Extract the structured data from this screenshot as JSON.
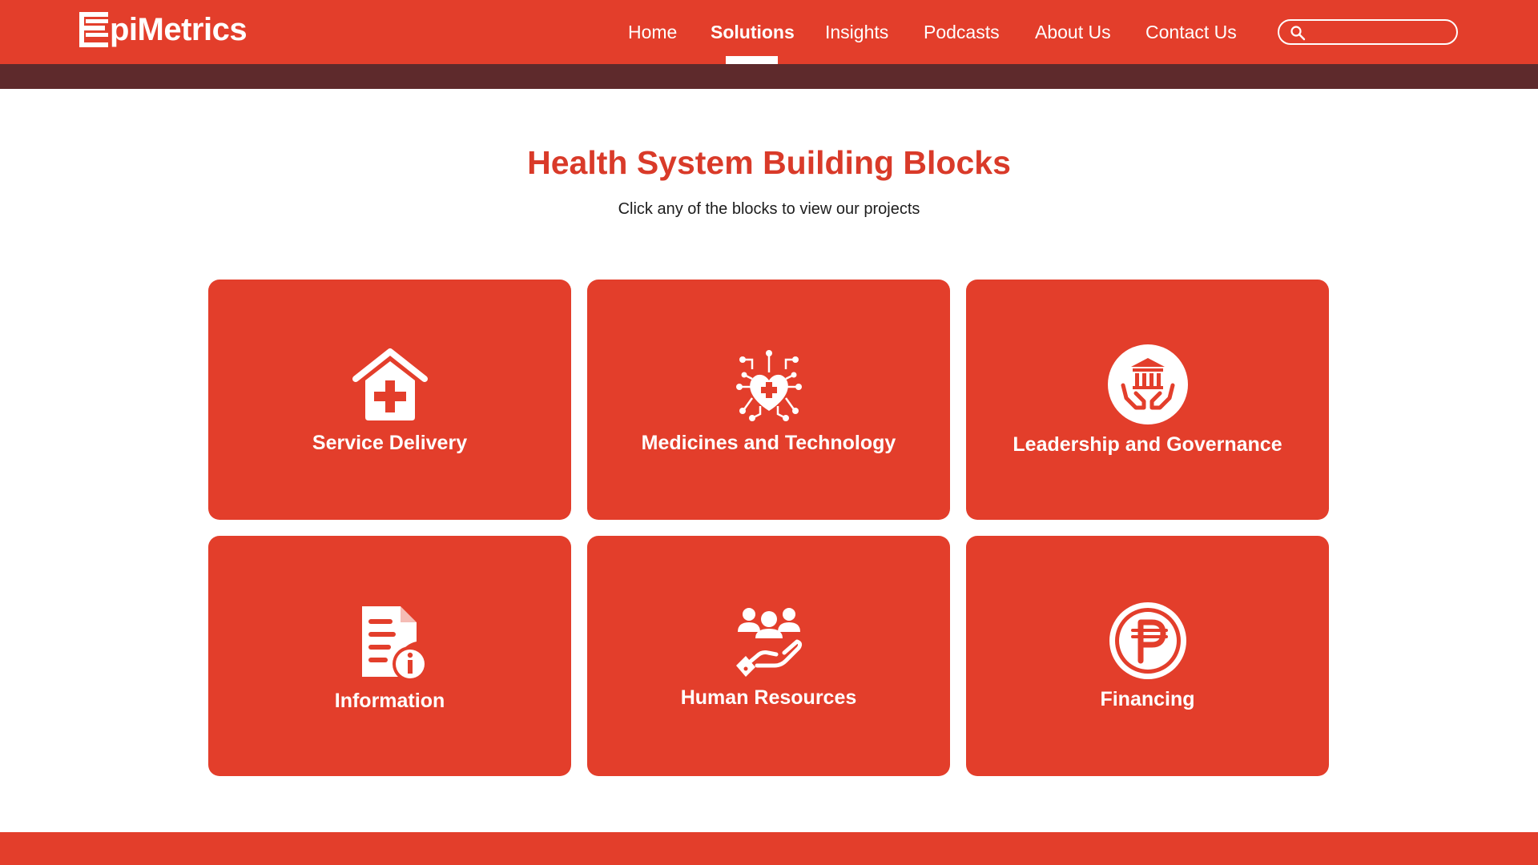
{
  "brand": {
    "name": "EpiMetrics",
    "logo_text": "piMetrics"
  },
  "nav": {
    "items": [
      {
        "label": "Home"
      },
      {
        "label": "Solutions",
        "active": true
      },
      {
        "label": "Insights"
      },
      {
        "label": "Podcasts"
      },
      {
        "label": "About Us"
      },
      {
        "label": "Contact Us"
      }
    ]
  },
  "search": {
    "placeholder": "",
    "value": ""
  },
  "main": {
    "title": "Health System Building Blocks",
    "subtitle": "Click any of the blocks to view our projects"
  },
  "blocks": [
    {
      "label": "Service Delivery",
      "icon": "hospital-icon"
    },
    {
      "label": "Medicines and Technology",
      "icon": "heart-network-icon"
    },
    {
      "label": "Leadership and Governance",
      "icon": "hands-building-icon"
    },
    {
      "label": "Information",
      "icon": "document-info-icon"
    },
    {
      "label": "Human Resources",
      "icon": "people-hand-icon"
    },
    {
      "label": "Financing",
      "icon": "peso-coin-icon"
    }
  ],
  "colors": {
    "primary": "#e33e2b",
    "title": "#d93a29",
    "band": "#5e2a2c",
    "text": "#1d1d1d",
    "white": "#ffffff"
  }
}
